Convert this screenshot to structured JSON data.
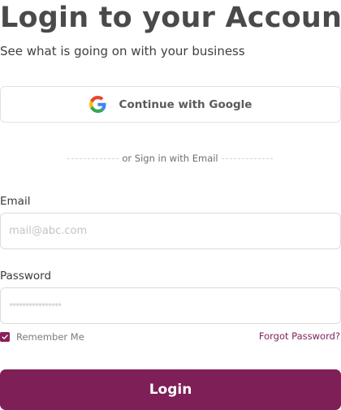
{
  "header": {
    "title": "Login to your Account",
    "subtitle": "See what is going on with your business"
  },
  "google_button": {
    "label": "Continue with Google",
    "icon": "google-icon"
  },
  "divider": {
    "text": "or Sign in with Email"
  },
  "form": {
    "email_label": "Email",
    "email_placeholder": "mail@abc.com",
    "email_value": "",
    "password_label": "Password",
    "password_placeholder": "****************",
    "password_value": "",
    "remember_label": "Remember Me",
    "remember_checked": true,
    "forgot_label": "Forgot Password?",
    "login_label": "Login"
  },
  "colors": {
    "accent": "#7e1f57",
    "border": "#dcdcdc",
    "text": "#3b3b3b"
  }
}
